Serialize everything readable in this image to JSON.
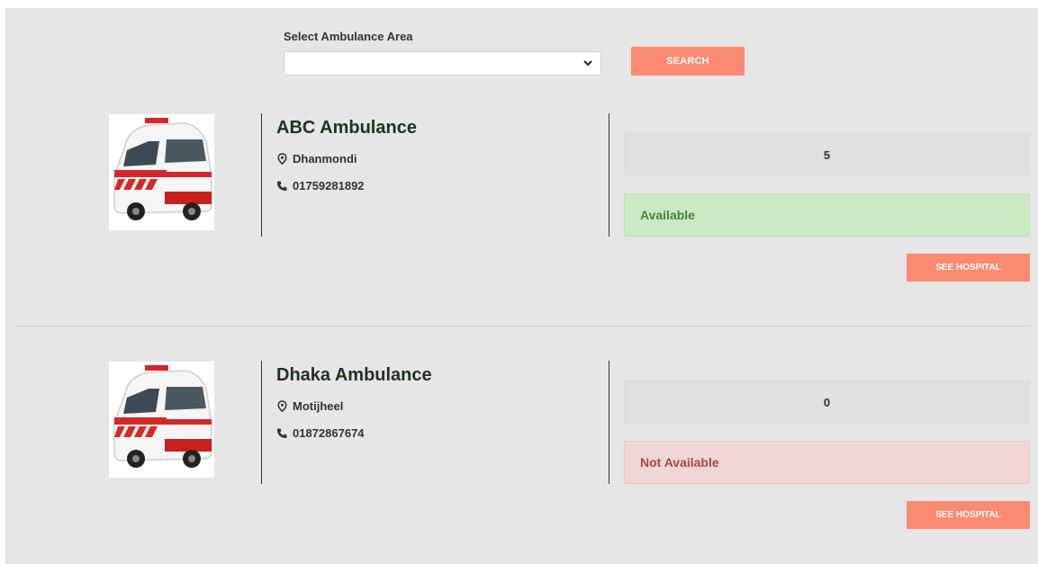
{
  "search": {
    "label": "Select Ambulance Area",
    "selected_value": "",
    "button_label": "SEARCH"
  },
  "ambulances": [
    {
      "name": "ABC Ambulance",
      "area": "Dhanmondi",
      "phone": "01759281892",
      "count": "5",
      "status": "Available",
      "button_label": "SEE HOSPITAL"
    },
    {
      "name": "Dhaka Ambulance",
      "area": "Motijheel",
      "phone": "01872867674",
      "count": "0",
      "status": "Not Available",
      "button_label": "SEE HOSPITAL"
    }
  ],
  "colors": {
    "accent": "#fb8a72",
    "available_bg": "#cbe9c4",
    "available_text": "#4d7f42",
    "unavailable_bg": "#f1d6d6",
    "unavailable_text": "#a54848"
  },
  "icons": {
    "location": "map-pin-icon",
    "phone": "phone-icon",
    "dropdown": "chevron-down-icon",
    "ambulance_image": "ambulance-image"
  }
}
